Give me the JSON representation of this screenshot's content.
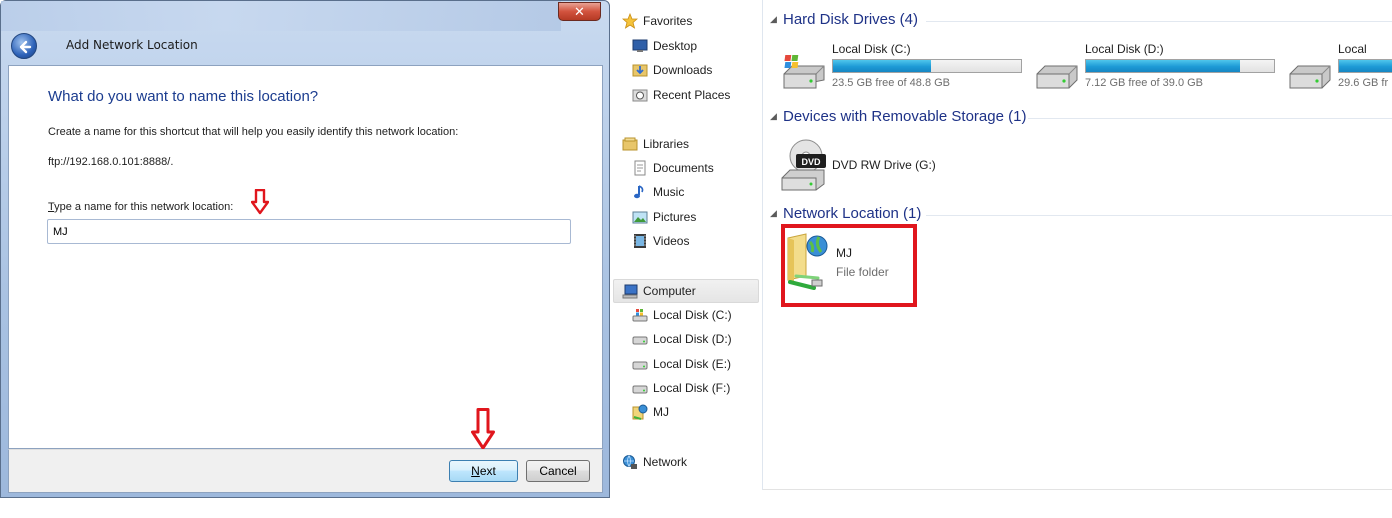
{
  "wizard": {
    "close_label": "✕",
    "title": "Add Network Location",
    "heading": "What do you want to name this location?",
    "instruction": "Create a name for this shortcut that will help you easily identify this network location:",
    "address": "ftp://192.168.0.101:8888/.",
    "field_label_accesskey": "T",
    "field_label_rest": "ype a name for this network location:",
    "field_value": "MJ",
    "next_accesskey": "N",
    "next_rest": "ext",
    "cancel_label": "Cancel",
    "arrow_color": "#e0161d"
  },
  "explorer": {
    "nav": {
      "favorites": "Favorites",
      "desktop": "Desktop",
      "downloads": "Downloads",
      "recent_places": "Recent Places",
      "libraries": "Libraries",
      "documents": "Documents",
      "music": "Music",
      "pictures": "Pictures",
      "videos": "Videos",
      "computer": "Computer",
      "disk_c": "Local Disk (C:)",
      "disk_d": "Local Disk (D:)",
      "disk_e": "Local Disk (E:)",
      "disk_f": "Local Disk (F:)",
      "mj": "MJ",
      "network": "Network"
    },
    "groups": {
      "hard_disks": "Hard Disk Drives (4)",
      "removable": "Devices with Removable Storage (1)",
      "network_location": "Network Location (1)"
    },
    "drives": [
      {
        "name": "Local Disk (C:)",
        "free_text": "23.5 GB free of 48.8 GB",
        "used_fraction": 0.52
      },
      {
        "name": "Local Disk (D:)",
        "free_text": "7.12 GB free of 39.0 GB",
        "used_fraction": 0.82
      },
      {
        "name": "Local",
        "free_text": "29.6 GB fr",
        "used_fraction": 0.6
      }
    ],
    "dvd": {
      "name": "DVD RW Drive (G:)",
      "badge": "DVD"
    },
    "network_item": {
      "name": "MJ",
      "type": "File folder"
    },
    "highlight_color": "#e0161d"
  }
}
